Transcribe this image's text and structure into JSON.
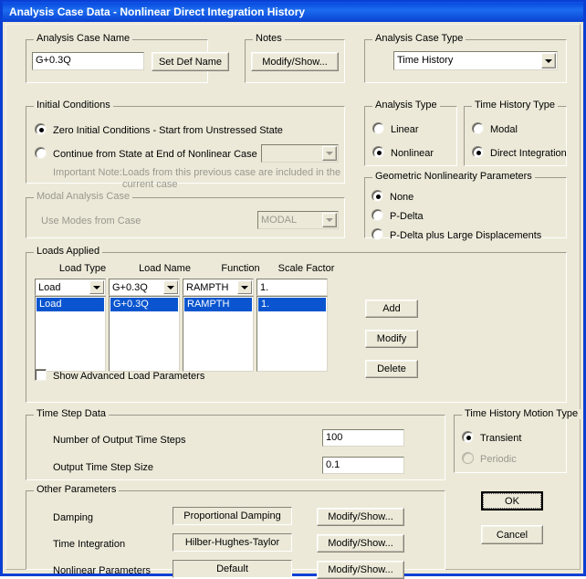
{
  "window": {
    "title": "Analysis Case Data  -  Nonlinear Direct Integration History"
  },
  "analysis_case_name": {
    "group_title": "Analysis Case Name",
    "value": "G+0.3Q",
    "set_def_name_label": "Set Def Name"
  },
  "notes": {
    "group_title": "Notes",
    "modify_show_label": "Modify/Show..."
  },
  "analysis_case_type": {
    "group_title": "Analysis Case Type",
    "selected": "Time History"
  },
  "initial_conditions": {
    "group_title": "Initial Conditions",
    "option_zero": "Zero Initial Conditions - Start from Unstressed State",
    "option_continue": "Continue from State at End of Nonlinear Case",
    "continue_case_value": "",
    "note_label": "Important Note:",
    "note_line1": "Loads from this previous case are included in the",
    "note_line2": "current case",
    "selected": "zero"
  },
  "modal_analysis_case": {
    "group_title": "Modal Analysis Case",
    "use_modes_label": "Use Modes from Case",
    "selected": "MODAL",
    "disabled": true
  },
  "analysis_type": {
    "group_title": "Analysis Type",
    "options": [
      "Linear",
      "Nonlinear"
    ],
    "selected": "Nonlinear"
  },
  "time_history_type": {
    "group_title": "Time History Type",
    "options": [
      "Modal",
      "Direct Integration"
    ],
    "selected": "Direct Integration"
  },
  "geometric_nonlinearity": {
    "group_title": "Geometric Nonlinearity Parameters",
    "options": [
      "None",
      "P-Delta",
      "P-Delta plus Large Displacements"
    ],
    "selected": "None"
  },
  "loads_applied": {
    "group_title": "Loads Applied",
    "columns": [
      "Load Type",
      "Load Name",
      "Function",
      "Scale Factor"
    ],
    "edit_row": {
      "load_type": "Load",
      "load_name": "G+0.3Q",
      "function": "RAMPTH",
      "scale_factor": "1."
    },
    "rows": [
      {
        "load_type": "Load",
        "load_name": "G+0.3Q",
        "function": "RAMPTH",
        "scale_factor": "1."
      }
    ],
    "buttons": {
      "add": "Add",
      "modify": "Modify",
      "delete": "Delete"
    },
    "show_advanced_label": "Show Advanced Load Parameters",
    "show_advanced_checked": false
  },
  "time_step_data": {
    "group_title": "Time Step Data",
    "number_of_output_time_steps_label": "Number of Output Time Steps",
    "number_of_output_time_steps_value": "100",
    "output_time_step_size_label": "Output Time Step Size",
    "output_time_step_size_value": "0.1"
  },
  "time_history_motion_type": {
    "group_title": "Time History Motion Type",
    "options": [
      "Transient",
      "Periodic"
    ],
    "selected": "Transient",
    "disabled_options": [
      "Periodic"
    ]
  },
  "other_parameters": {
    "group_title": "Other Parameters",
    "rows": [
      {
        "label": "Damping",
        "value": "Proportional Damping",
        "button": "Modify/Show..."
      },
      {
        "label": "Time Integration",
        "value": "Hilber-Hughes-Taylor",
        "button": "Modify/Show..."
      },
      {
        "label": "Nonlinear Parameters",
        "value": "Default",
        "button": "Modify/Show..."
      }
    ]
  },
  "dialog_buttons": {
    "ok": "OK",
    "cancel": "Cancel"
  },
  "colors": {
    "titlebar": "#0a4ce0",
    "dialog_face": "#ece9d8",
    "selection": "#0a55cf",
    "field_bg": "#ffffff",
    "disabled_text": "#9a988e"
  }
}
